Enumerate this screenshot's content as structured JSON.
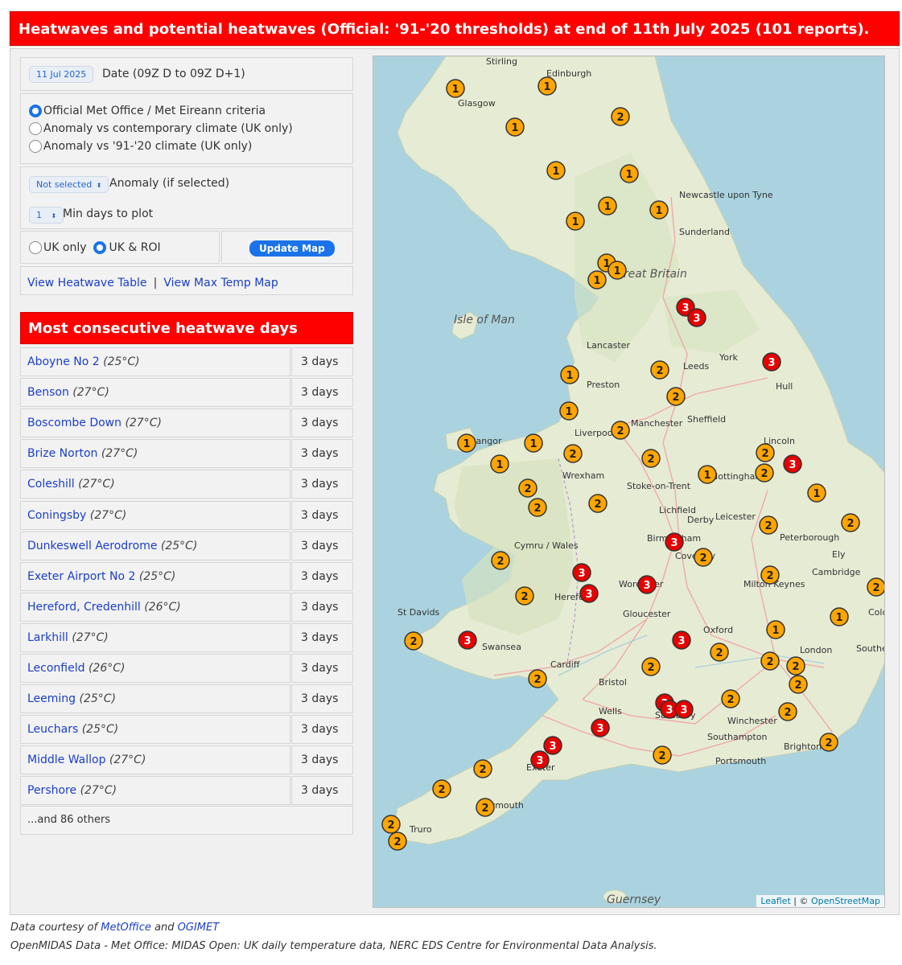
{
  "banner": {
    "title": "Heatwaves and potential heatwaves (Official: '91-'20 thresholds) at end of 11th July 2025 (101 reports)."
  },
  "controls": {
    "date_value": "11 Jul 2025",
    "date_label": "Date (09Z D to 09Z D+1)",
    "criteria": [
      {
        "label": "Official Met Office / Met Eireann criteria",
        "selected": true
      },
      {
        "label": "Anomaly vs contemporary climate (UK only)",
        "selected": false
      },
      {
        "label": "Anomaly vs '91-'20 climate (UK only)",
        "selected": false
      }
    ],
    "anomaly_select": "Not selected",
    "anomaly_label": "Anomaly (if selected)",
    "min_days_select": "1",
    "min_days_label": "Min days to plot",
    "region": [
      {
        "label": "UK only",
        "selected": false
      },
      {
        "label": "UK & ROI",
        "selected": true
      }
    ],
    "update_button": "Update Map",
    "link_table": "View Heatwave Table",
    "link_separator": "|",
    "link_maxtemp": "View Max Temp Map"
  },
  "table": {
    "title": "Most consecutive heatwave days",
    "rows": [
      {
        "name": "Aboyne No 2",
        "threshold": "(25°C)",
        "days": "3 days"
      },
      {
        "name": "Benson",
        "threshold": "(27°C)",
        "days": "3 days"
      },
      {
        "name": "Boscombe Down",
        "threshold": "(27°C)",
        "days": "3 days"
      },
      {
        "name": "Brize Norton",
        "threshold": "(27°C)",
        "days": "3 days"
      },
      {
        "name": "Coleshill",
        "threshold": "(27°C)",
        "days": "3 days"
      },
      {
        "name": "Coningsby",
        "threshold": "(27°C)",
        "days": "3 days"
      },
      {
        "name": "Dunkeswell Aerodrome",
        "threshold": "(25°C)",
        "days": "3 days"
      },
      {
        "name": "Exeter Airport No 2",
        "threshold": "(25°C)",
        "days": "3 days"
      },
      {
        "name": "Hereford, Credenhill",
        "threshold": "(26°C)",
        "days": "3 days"
      },
      {
        "name": "Larkhill",
        "threshold": "(27°C)",
        "days": "3 days"
      },
      {
        "name": "Leconfield",
        "threshold": "(26°C)",
        "days": "3 days"
      },
      {
        "name": "Leeming",
        "threshold": "(25°C)",
        "days": "3 days"
      },
      {
        "name": "Leuchars",
        "threshold": "(25°C)",
        "days": "3 days"
      },
      {
        "name": "Middle Wallop",
        "threshold": "(27°C)",
        "days": "3 days"
      },
      {
        "name": "Pershore",
        "threshold": "(27°C)",
        "days": "3 days"
      }
    ],
    "others": "...and 86 others"
  },
  "map": {
    "colors": {
      "sea": "#aad3df",
      "land": "#e8ecd8",
      "marker_1_2": "#ffa500",
      "marker_3": "#e60000"
    },
    "place_labels": [
      "Edinburgh",
      "Stirling",
      "Glasgow",
      "Newcastle upon Tyne",
      "Sunderland",
      "Great Britain",
      "Isle of Man",
      "Lancaster",
      "Preston",
      "Leeds",
      "York",
      "Hull",
      "Sheffield",
      "Liverpool",
      "Manchester",
      "Bangor",
      "Wrexham",
      "Stoke-on-Trent",
      "Derby",
      "Nottingham",
      "Lincoln",
      "Leicester",
      "Lichfield",
      "Birmingham",
      "Coventry",
      "Peterborough",
      "Ely",
      "Cambridge",
      "Cymru / Wales",
      "Hereford",
      "Worcester",
      "Gloucester",
      "Oxford",
      "Milton Keynes",
      "Colchester",
      "St Davids",
      "Swansea",
      "Cardiff",
      "Bristol",
      "London",
      "Southend-on-Sea",
      "Wells",
      "Salisbury",
      "Winchester",
      "Southampton",
      "Portsmouth",
      "Brighton",
      "Exeter",
      "Plymouth",
      "Truro",
      "Guernsey"
    ],
    "markers": [
      {
        "v": "1"
      },
      {
        "v": "1"
      },
      {
        "v": "2"
      },
      {
        "v": "1"
      },
      {
        "v": "1"
      },
      {
        "v": "1"
      },
      {
        "v": "1"
      },
      {
        "v": "1"
      },
      {
        "v": "1"
      },
      {
        "v": "1"
      },
      {
        "v": "1"
      },
      {
        "v": "1"
      },
      {
        "v": "3"
      },
      {
        "v": "3"
      },
      {
        "v": "3"
      },
      {
        "v": "1"
      },
      {
        "v": "2"
      },
      {
        "v": "2"
      },
      {
        "v": "1"
      },
      {
        "v": "2"
      },
      {
        "v": "1"
      },
      {
        "v": "1"
      },
      {
        "v": "2"
      },
      {
        "v": "1"
      },
      {
        "v": "2"
      },
      {
        "v": "2"
      },
      {
        "v": "3"
      },
      {
        "v": "2"
      },
      {
        "v": "1"
      },
      {
        "v": "1"
      },
      {
        "v": "2"
      },
      {
        "v": "2"
      },
      {
        "v": "2"
      },
      {
        "v": "2"
      },
      {
        "v": "3"
      },
      {
        "v": "2"
      },
      {
        "v": "2"
      },
      {
        "v": "3"
      },
      {
        "v": "3"
      },
      {
        "v": "3"
      },
      {
        "v": "2"
      },
      {
        "v": "2"
      },
      {
        "v": "2"
      },
      {
        "v": "2"
      },
      {
        "v": "1"
      },
      {
        "v": "1"
      },
      {
        "v": "2"
      },
      {
        "v": "3"
      },
      {
        "v": "3"
      },
      {
        "v": "2"
      },
      {
        "v": "2"
      },
      {
        "v": "2"
      },
      {
        "v": "2"
      },
      {
        "v": "2"
      },
      {
        "v": "3"
      },
      {
        "v": "3"
      },
      {
        "v": "3"
      },
      {
        "v": "2"
      },
      {
        "v": "2"
      },
      {
        "v": "2"
      },
      {
        "v": "3"
      },
      {
        "v": "2"
      },
      {
        "v": "3"
      },
      {
        "v": "3"
      },
      {
        "v": "2"
      },
      {
        "v": "2"
      },
      {
        "v": "2"
      },
      {
        "v": "2"
      },
      {
        "v": "2"
      },
      {
        "v": "2"
      }
    ],
    "attribution_leaflet": "Leaflet",
    "attribution_sep": "| ©",
    "attribution_osm": "OpenStreetMap"
  },
  "footer": {
    "line1_prefix": "Data courtesy of",
    "line1_link1": "MetOffice",
    "line1_and": "and",
    "line1_link2": "OGIMET",
    "line2": "OpenMIDAS Data - Met Office: MIDAS Open: UK daily temperature data, NERC EDS Centre for Environmental Data Analysis."
  }
}
